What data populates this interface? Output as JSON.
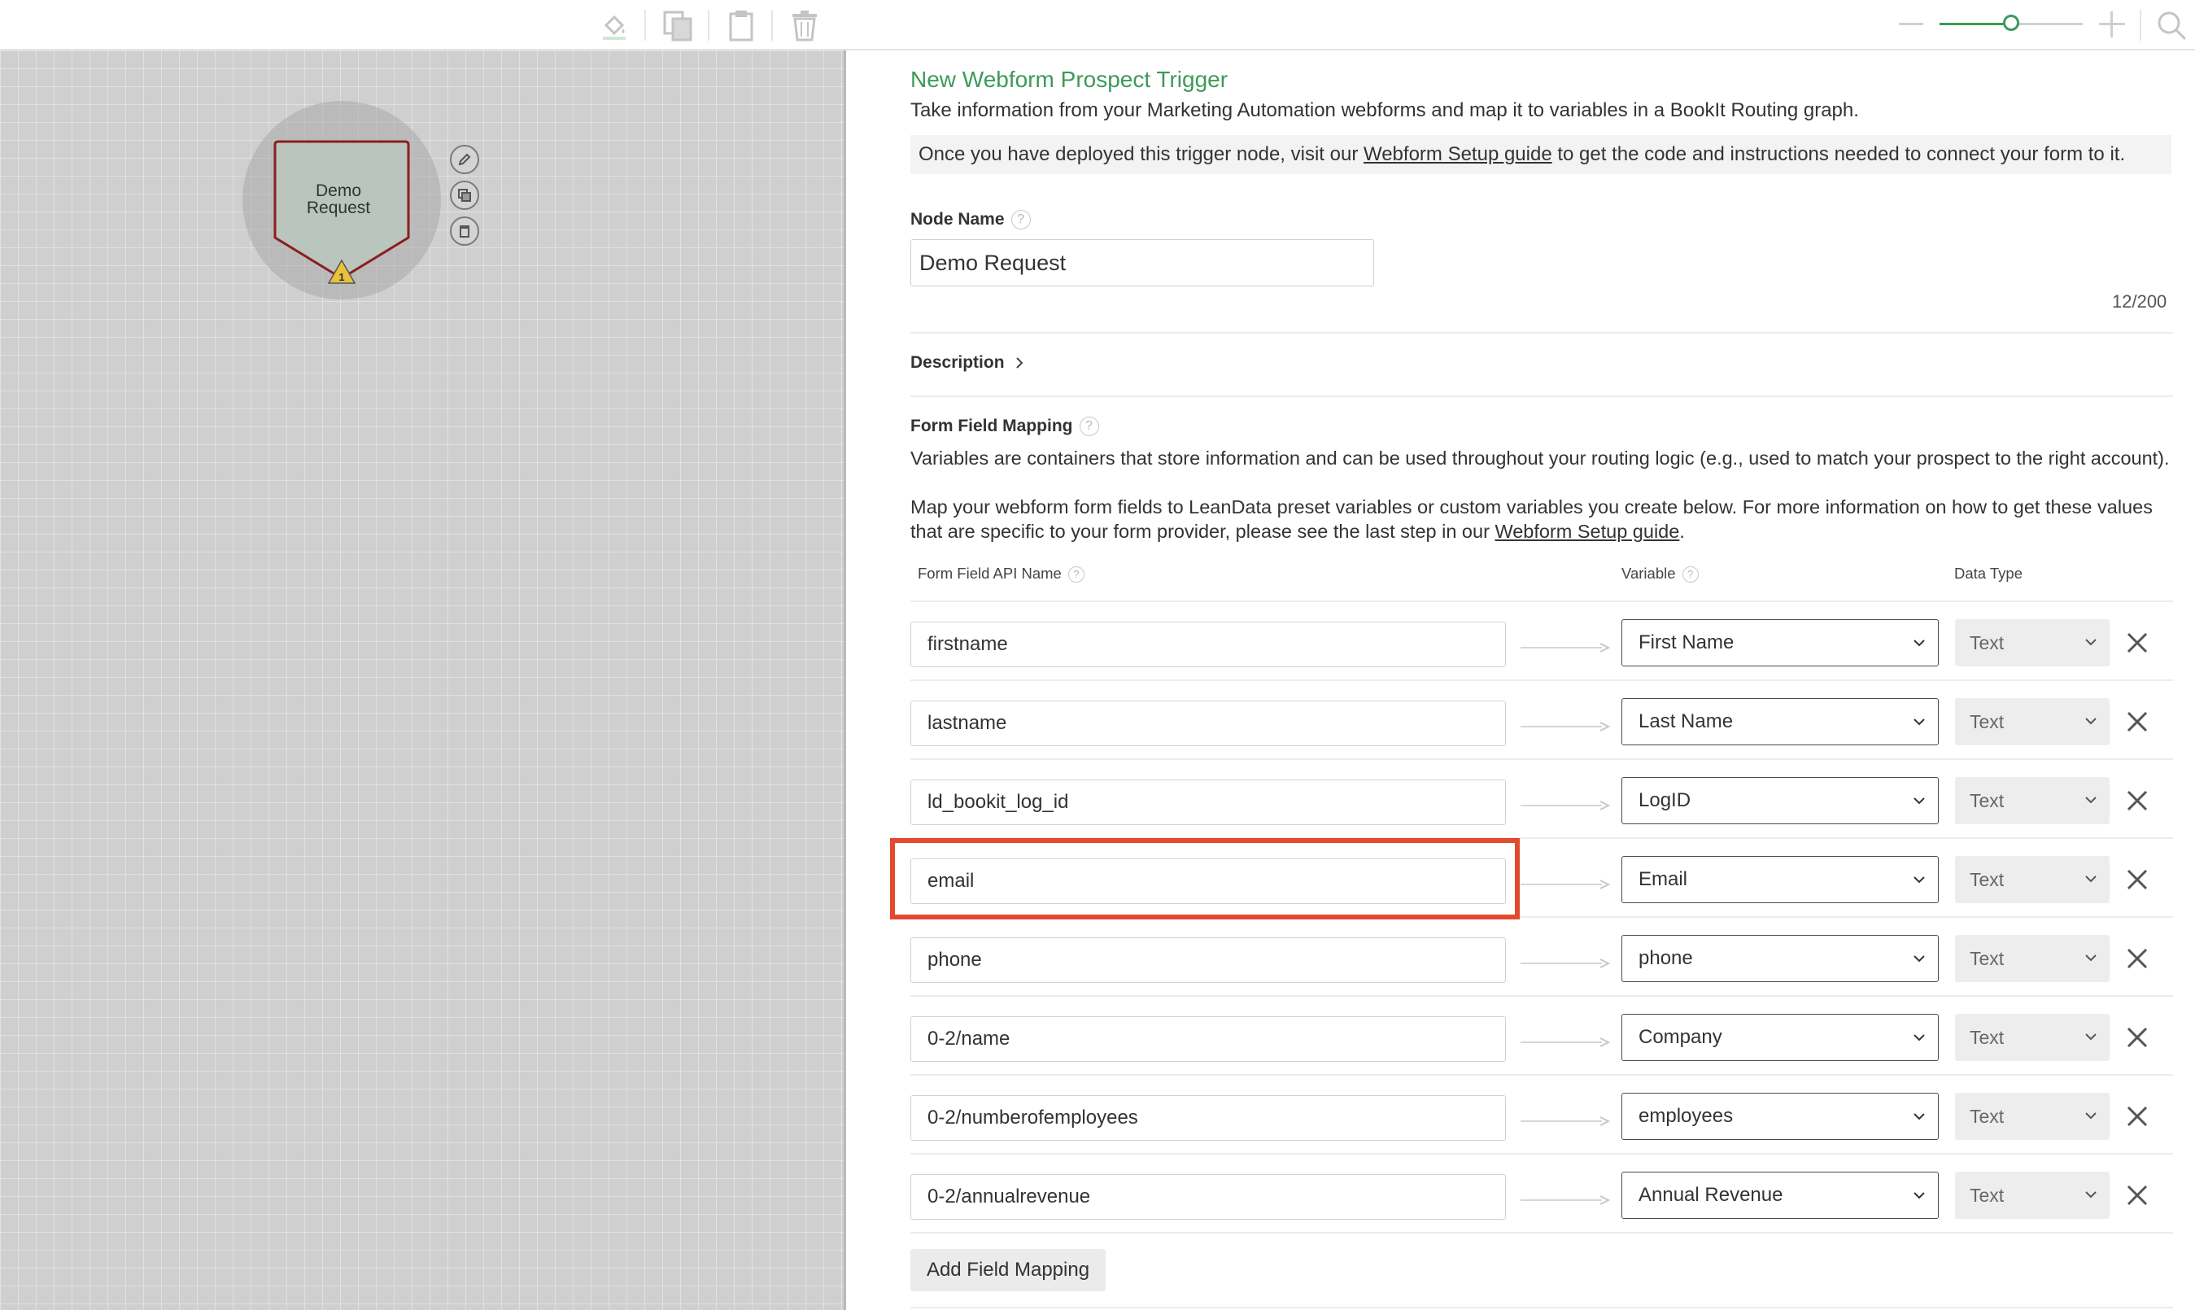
{
  "toolbar": {
    "icons": [
      "paint-bucket-icon",
      "copy-icon",
      "paste-icon",
      "trash-icon"
    ],
    "zoom": {
      "level": 0.5,
      "minus": "−",
      "plus": "+"
    }
  },
  "canvas": {
    "node": {
      "label_line1": "Demo",
      "label_line2": "Request",
      "warning_count": "1"
    },
    "controls": [
      "edit-icon",
      "duplicate-icon",
      "delete-icon"
    ]
  },
  "panel": {
    "title": "New Webform Prospect Trigger",
    "subtitle": "Take information from your Marketing Automation webforms and map it to variables in a BookIt Routing graph.",
    "info_prefix": "Once you have deployed this trigger node, visit our ",
    "info_link": "Webform Setup guide",
    "info_suffix": " to get the code and instructions needed to connect your form to it.",
    "node_name_label": "Node Name",
    "node_name_value": "Demo Request",
    "node_name_counter": "12/200",
    "description_label": "Description",
    "mapping_label": "Form Field Mapping",
    "mapping_text1": "Variables are containers that store information and can be used throughout your routing logic (e.g., used to match your prospect to the right account).",
    "mapping_text2_prefix": "Map your webform form fields to LeanData preset variables or custom variables you create below. For more information on how to get these values that are specific to your form provider, please see the last step in our ",
    "mapping_text2_link": "Webform Setup guide",
    "mapping_text2_suffix": ".",
    "col_api_name": "Form Field API Name",
    "col_variable": "Variable",
    "col_data_type": "Data Type",
    "help_glyph": "?",
    "rows": [
      {
        "api_name": "firstname",
        "variable": "First Name",
        "data_type": "Text"
      },
      {
        "api_name": "lastname",
        "variable": "Last Name",
        "data_type": "Text"
      },
      {
        "api_name": "ld_bookit_log_id",
        "variable": "LogID",
        "data_type": "Text"
      },
      {
        "api_name": "email",
        "variable": "Email",
        "data_type": "Text"
      },
      {
        "api_name": "phone",
        "variable": "phone",
        "data_type": "Text"
      },
      {
        "api_name": "0-2/name",
        "variable": "Company",
        "data_type": "Text"
      },
      {
        "api_name": "0-2/numberofemployees",
        "variable": "employees",
        "data_type": "Text"
      },
      {
        "api_name": "0-2/annualrevenue",
        "variable": "Annual Revenue",
        "data_type": "Text"
      }
    ],
    "add_button": "Add Field Mapping"
  },
  "colors": {
    "title_green": "#3d9a58",
    "highlight_red": "#e24a2e",
    "canvas_gray": "#cfcfcf"
  }
}
